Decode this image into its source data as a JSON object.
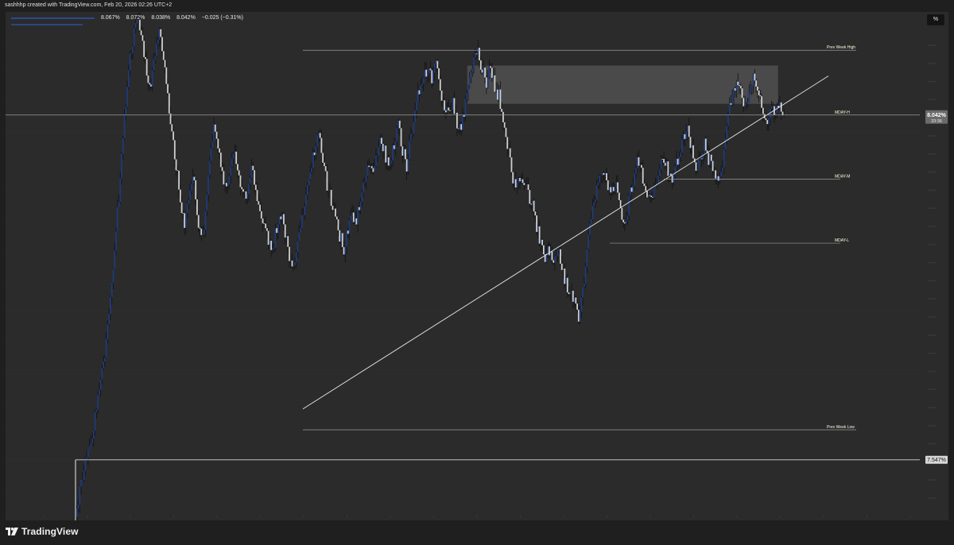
{
  "header": {
    "credit": "sashhhp created with TradingView.com, Feb 20, 2026 02:26 UTC+2"
  },
  "legend": {
    "values": [
      "8.067%",
      "8.072%",
      "8.038%",
      "8.042%",
      "−0.025 (−0.31%)"
    ]
  },
  "toolbar": {
    "scale_button": "%"
  },
  "levels": {
    "prev_week_high": "Prev Week High",
    "prev_week_low": "Prev Week Low",
    "mday_h": "MDAY-H",
    "mday_m": "MDAY-M",
    "mday_l": "MDAY-L"
  },
  "price_tags": {
    "last_price": "8.042%",
    "countdown": "33:36",
    "marked_level": "7.547%"
  },
  "brand": {
    "name": "TradingView"
  },
  "colors": {
    "chart_bg": "#2b2b2b",
    "outer_bg": "#1f1f1f",
    "candle_up": "#1e3a7a",
    "candle_down": "#cfcfcf",
    "wick": "#111111",
    "level_line": "#9a9a9a",
    "trendline": "#e6e6e6",
    "zone": "#4a4a4a",
    "label_text": "#fffbe0",
    "price_tag_bg": "#6b6b6b",
    "marked_tag_bg": "#d8d8d8"
  },
  "chart_data": {
    "type": "candlestick",
    "y_unit": "%",
    "ylim": [
      7.46,
      8.19
    ],
    "last_price": 8.042,
    "marked_level": 7.547,
    "levels": [
      {
        "name": "Prev Week High",
        "y": 8.135
      },
      {
        "name": "MDAY-H",
        "y": 8.042
      },
      {
        "name": "MDAY-M",
        "y": 7.95
      },
      {
        "name": "MDAY-L",
        "y": 7.858
      },
      {
        "name": "Prev Week Low",
        "y": 7.59
      }
    ],
    "zone": {
      "x_from": 0.505,
      "x_to": 0.845,
      "y_from": 8.058,
      "y_to": 8.113
    },
    "close_path": [
      7.475,
      7.5,
      7.54,
      7.56,
      7.58,
      7.62,
      7.66,
      7.7,
      7.76,
      7.82,
      7.9,
      7.98,
      8.06,
      8.12,
      8.16,
      8.18,
      8.14,
      8.1,
      8.08,
      8.13,
      8.16,
      8.12,
      8.07,
      8.02,
      7.97,
      7.92,
      7.88,
      7.93,
      7.96,
      7.9,
      7.86,
      7.9,
      7.98,
      8.03,
      8.0,
      7.96,
      7.93,
      7.96,
      7.99,
      7.95,
      7.93,
      7.92,
      7.97,
      7.94,
      7.9,
      7.88,
      7.86,
      7.85,
      7.88,
      7.9,
      7.87,
      7.84,
      7.82,
      7.86,
      7.9,
      7.92,
      7.96,
      7.99,
      8.02,
      7.98,
      7.94,
      7.92,
      7.89,
      7.87,
      7.85,
      7.88,
      7.9,
      7.89,
      7.92,
      7.95,
      7.97,
      7.96,
      7.99,
      8.01,
      7.98,
      7.97,
      8.0,
      8.03,
      7.99,
      7.97,
      8.01,
      8.05,
      8.08,
      8.1,
      8.11,
      8.09,
      8.12,
      8.08,
      8.05,
      8.04,
      8.06,
      8.03,
      8.02,
      8.06,
      8.09,
      8.12,
      8.13,
      8.11,
      8.09,
      8.11,
      8.08,
      8.07,
      8.04,
      8.0,
      7.96,
      7.93,
      7.95,
      7.94,
      7.93,
      7.91,
      7.88,
      7.86,
      7.84,
      7.85,
      7.83,
      7.85,
      7.82,
      7.8,
      7.79,
      7.77,
      7.75,
      7.79,
      7.84,
      7.9,
      7.93,
      7.95,
      7.96,
      7.94,
      7.93,
      7.95,
      7.91,
      7.88,
      7.92,
      7.95,
      7.98,
      7.96,
      7.94,
      7.92,
      7.93,
      7.96,
      7.98,
      7.97,
      7.95,
      7.96,
      7.99,
      8.01,
      8.02,
      7.99,
      7.96,
      7.98,
      8.0,
      7.98,
      7.97,
      7.95,
      7.96,
      8.0,
      8.05,
      8.08,
      8.09,
      8.07,
      8.05,
      8.08,
      8.1,
      8.07,
      8.05,
      8.03,
      8.05,
      8.04,
      8.06,
      8.042
    ]
  }
}
